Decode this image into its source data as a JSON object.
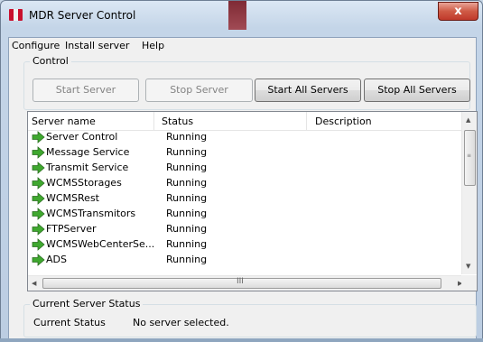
{
  "window": {
    "title": "MDR Server Control",
    "close_glyph": "x"
  },
  "menu": {
    "items": [
      "Configure",
      "Install server",
      "Help"
    ]
  },
  "control": {
    "group_label": "Control",
    "buttons": {
      "start_server": "Start Server",
      "stop_server": "Stop Server",
      "start_all": "Start All Servers",
      "stop_all": "Stop All Servers"
    }
  },
  "server_list": {
    "columns": [
      "Server name",
      "Status",
      "Description"
    ],
    "rows": [
      {
        "name": "Server Control",
        "status": "Running"
      },
      {
        "name": "Message Service",
        "status": "Running"
      },
      {
        "name": "Transmit Service",
        "status": "Running"
      },
      {
        "name": "WCMSStorages",
        "status": "Running"
      },
      {
        "name": "WCMSRest",
        "status": "Running"
      },
      {
        "name": "WCMSTransmitors",
        "status": "Running"
      },
      {
        "name": "FTPServer",
        "status": "Running"
      },
      {
        "name": "WCMSWebCenterSe...",
        "status": "Running"
      },
      {
        "name": "ADS",
        "status": "Running"
      }
    ],
    "row_icon": "green-arrow-right-icon",
    "hscroll_grip": "III"
  },
  "status_group": {
    "label": "Current Server Status",
    "field_label": "Current Status",
    "field_value": "No server selected."
  },
  "colors": {
    "running_arrow": "#3fa82f",
    "close_button": "#c0392b"
  }
}
